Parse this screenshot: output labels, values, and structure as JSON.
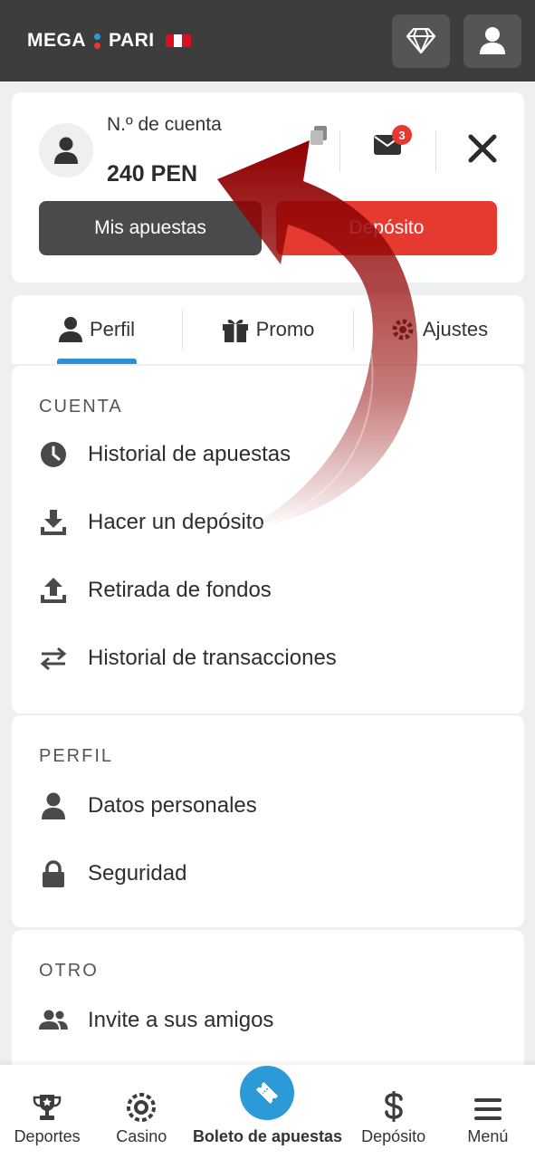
{
  "header": {
    "logo_left": "MEGA",
    "logo_right": "PARI",
    "icons": [
      "diamond-icon",
      "user-icon"
    ],
    "colors": {
      "bar": "#3d3d3d",
      "logo_dot_blue": "#2d9ad8",
      "logo_dot_red": "#e63a31"
    }
  },
  "account": {
    "label": "N.º de cuenta",
    "balance": "240 PEN",
    "unread_messages": "3",
    "my_bets_label": "Mis apuestas",
    "deposit_label": "Depósito"
  },
  "tabs": [
    {
      "label": "Perfil",
      "icon": "person-icon",
      "active": true
    },
    {
      "label": "Promo",
      "icon": "gift-icon",
      "active": false
    },
    {
      "label": "Ajustes",
      "icon": "gear-icon",
      "active": false
    }
  ],
  "sections": {
    "cuenta": {
      "title": "CUENTA",
      "items": [
        {
          "label": "Historial de apuestas",
          "icon": "clock-icon"
        },
        {
          "label": "Hacer un depósito",
          "icon": "download-tray-icon"
        },
        {
          "label": "Retirada de fondos",
          "icon": "upload-tray-icon"
        },
        {
          "label": "Historial de transacciones",
          "icon": "swap-arrows-icon"
        }
      ]
    },
    "perfil": {
      "title": "PERFIL",
      "items": [
        {
          "label": "Datos personales",
          "icon": "person-icon"
        },
        {
          "label": "Seguridad",
          "icon": "lock-icon"
        }
      ]
    },
    "otro": {
      "title": "OTRO",
      "items": [
        {
          "label": "Invite a sus amigos",
          "icon": "people-icon"
        }
      ]
    }
  },
  "bottom_nav": [
    {
      "label": "Deportes",
      "icon": "trophy-icon"
    },
    {
      "label": "Casino",
      "icon": "casino-chip-icon"
    },
    {
      "label": "Boleto de apuestas",
      "icon": "ticket-icon"
    },
    {
      "label": "Depósito",
      "icon": "dollar-icon"
    },
    {
      "label": "Menú",
      "icon": "hamburger-icon"
    }
  ],
  "accent_colors": {
    "primary_blue": "#2d9ad8",
    "deposit_red": "#e63a31",
    "arrow_red": "#8e0000"
  }
}
